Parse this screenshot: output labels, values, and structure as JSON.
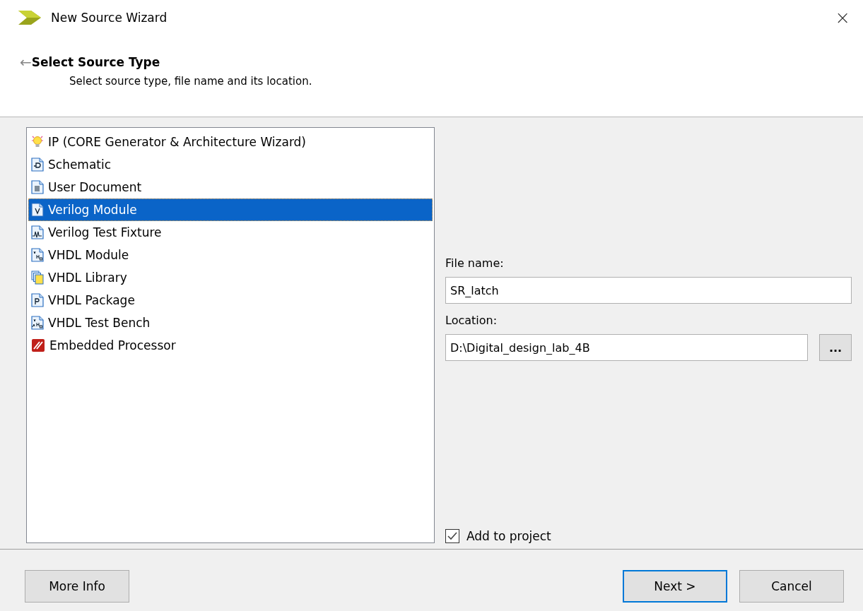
{
  "window": {
    "title": "New Source Wizard",
    "close": "×"
  },
  "header": {
    "back": "←",
    "title": "Select Source Type",
    "subtitle": "Select source type, file name and its location."
  },
  "source_types": [
    {
      "label": "IP (CORE Generator & Architecture Wizard)",
      "kind": "lightbulb",
      "selected": false
    },
    {
      "label": "Schematic",
      "kind": "schematic",
      "selected": false
    },
    {
      "label": "User Document",
      "kind": "document",
      "selected": false
    },
    {
      "label": "Verilog Module",
      "kind": "letter-v",
      "selected": true
    },
    {
      "label": "Verilog Test Fixture",
      "kind": "waveform",
      "selected": false
    },
    {
      "label": "VHDL Module",
      "kind": "vhdl",
      "selected": false
    },
    {
      "label": "VHDL Library",
      "kind": "library",
      "selected": false
    },
    {
      "label": "VHDL Package",
      "kind": "letter-p",
      "selected": false
    },
    {
      "label": "VHDL Test Bench",
      "kind": "vhdl-wave",
      "selected": false
    },
    {
      "label": "Embedded Processor",
      "kind": "processor",
      "selected": false
    }
  ],
  "file_name": {
    "label": "File name:",
    "value": "SR_latch"
  },
  "location": {
    "label": "Location:",
    "value": "D:\\Digital_design_lab_4B",
    "browse": "..."
  },
  "add_to_project": {
    "label": "Add to project",
    "checked": true
  },
  "buttons": [
    {
      "label": "More Info",
      "kind": "left",
      "default": false
    },
    {
      "label": "Next >",
      "kind": "right",
      "default": true
    },
    {
      "label": "Cancel",
      "kind": "right",
      "default": false
    }
  ]
}
